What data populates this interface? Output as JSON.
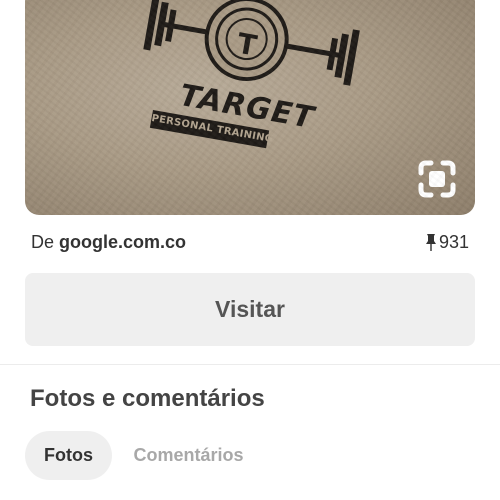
{
  "pin": {
    "image": {
      "logo_title": "TARGET",
      "logo_subtitle": "PERSONAL TRAINING",
      "logo_monogram": "T",
      "lens_icon": "visual-search-icon"
    },
    "source": {
      "prefix": "De",
      "domain": "google.com.co"
    },
    "save_count": "931",
    "save_icon": "pushpin-icon"
  },
  "visit_button": {
    "label": "Visitar"
  },
  "photos_section": {
    "title": "Fotos e comentários",
    "tabs": [
      {
        "label": "Fotos",
        "active": true
      },
      {
        "label": "Comentários",
        "active": false
      }
    ]
  },
  "colors": {
    "button_bg": "#efefef",
    "text_primary": "#333333",
    "tab_inactive": "#a8a8a8"
  }
}
